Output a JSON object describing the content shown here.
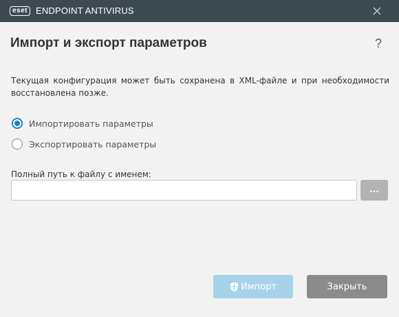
{
  "window": {
    "logo_text": "eset",
    "app_title": "ENDPOINT ANTIVIRUS"
  },
  "dialog": {
    "heading": "Импорт и экспорт параметров",
    "help": "?",
    "description": "Текущая конфигурация может быть сохранена в XML-файле и при необходимости восстановлена позже.",
    "options": [
      {
        "label": "Импортировать параметры",
        "checked": true
      },
      {
        "label": "Экспортировать параметры",
        "checked": false
      }
    ],
    "path_label": "Полный путь к файлу с именем:",
    "path_value": "",
    "browse_label": "...",
    "import_label": "Импорт",
    "close_label": "Закрыть"
  },
  "colors": {
    "titlebar": "#3d4a52",
    "accent": "#1b7fb8",
    "import_button_disabled": "#a6d3ea",
    "close_button": "#8b8b8b"
  },
  "icons": [
    "close-icon",
    "help-icon",
    "shield-icon"
  ]
}
